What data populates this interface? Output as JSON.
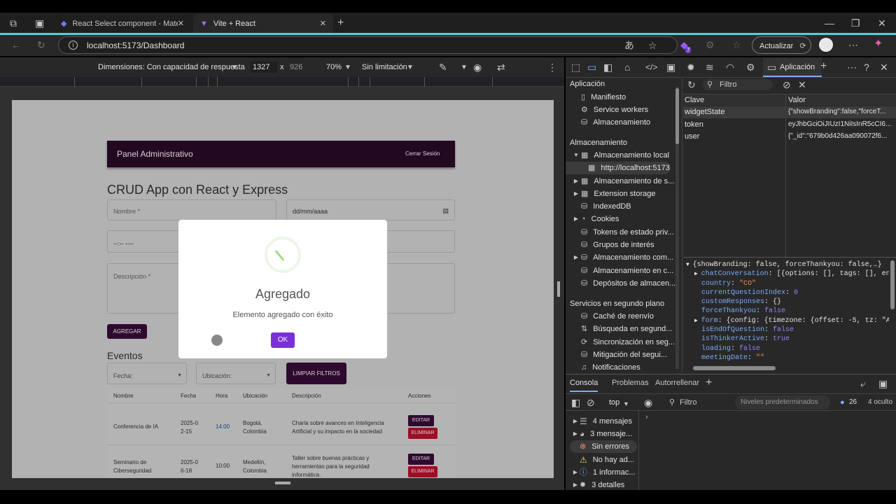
{
  "browser": {
    "tabs": [
      {
        "label": "React Select component - Materi"
      },
      {
        "label": "Vite + React"
      }
    ],
    "url": "localhost:5173/Dashboard",
    "update_label": "Actualizar",
    "ext_badge": "7"
  },
  "device_toolbar": {
    "dimensions_label": "Dimensiones: Con capacidad de respuesta",
    "width": "1327",
    "height": "926",
    "times": "x",
    "zoom": "70%",
    "throttle": "Sin limitación"
  },
  "app": {
    "header_title": "Panel Administrativo",
    "logout": "Cerrar Sesión",
    "page_title": "CRUD App con React y Express",
    "form": {
      "name_label": "Nombre *",
      "date_placeholder": "dd/mm/aaaa",
      "time_placeholder": "--:-- ----",
      "description_label": "Descripción *",
      "add_button": "AGREGAR"
    },
    "events_title": "Eventos",
    "filters": {
      "date": "Fecha:",
      "location": "Ubicación:",
      "clear": "LIMPIAR FILTROS"
    },
    "table": {
      "headers": [
        "Nombre",
        "Fecha",
        "Hora",
        "Ubicación",
        "Descripción",
        "Acciones"
      ],
      "rows": [
        {
          "name": "Conferencia de IA",
          "date": "2025-02-15",
          "time": "14:00",
          "location": "Bogotá, Colombia",
          "description": "Charla sobre avances en Inteligencia Artificial y su impacto en la sociedad"
        },
        {
          "name": "Seminario de Ciberseguridad",
          "date": "2025-06-18",
          "time": "10:00",
          "location": "Medellín, Colombia",
          "description": "Taller sobre buenas prácticas y herramientas para la seguridad informática."
        }
      ],
      "edit_label": "EDITAR",
      "delete_label": "ELIMINAR"
    },
    "modal": {
      "title": "Agregado",
      "message": "Elemento agregado con éxito",
      "ok": "OK"
    }
  },
  "devtools": {
    "panel_tab": "Aplicación",
    "sidebar": {
      "app_section": "Aplicación",
      "app_items": [
        "Manifiesto",
        "Service workers",
        "Almacenamiento"
      ],
      "storage_section": "Almacenamiento",
      "storage_items": [
        "Almacenamiento local",
        "http://localhost:5173",
        "Almacenamiento de s...",
        "Extension storage",
        "IndexedDB",
        "Cookies",
        "Tokens de estado priv...",
        "Grupos de interés",
        "Almacenamiento com...",
        "Almacenamiento en c...",
        "Depósitos de almacen..."
      ],
      "bg_section": "Servicios en segundo plano",
      "bg_items": [
        "Caché de reenvío",
        "Búsqueda en segund...",
        "Sincronización en seg...",
        "Mitigación del segui...",
        "Notificaciones"
      ]
    },
    "filter_placeholder": "Filtro",
    "table": {
      "key_header": "Clave",
      "value_header": "Valor",
      "rows": [
        {
          "key": "widgetState",
          "value": "{\"showBranding\":false,\"forceT..."
        },
        {
          "key": "token",
          "value": "eyJhbGciOiJIUzI1NiIsInR5cCI6..."
        },
        {
          "key": "user",
          "value": "{\"_id\":\"679b0d426aa090072f6..."
        }
      ]
    },
    "preview": {
      "root": "{showBranding: false, forceThankyou: false,…}",
      "lines": [
        {
          "k": "chatConversation",
          "v": "[{options: [], tags: [], enabl"
        },
        {
          "k": "country",
          "v": "\"CO\""
        },
        {
          "k": "currentQuestionIndex",
          "v": "0"
        },
        {
          "k": "customResponses",
          "v": "{}"
        },
        {
          "k": "forceThankyou",
          "v": "false"
        },
        {
          "k": "form",
          "v": "{config: {timezone: {offset: -5, tz: \"Amer"
        },
        {
          "k": "isEndOfQuestion",
          "v": "false"
        },
        {
          "k": "isThinkerActive",
          "v": "true"
        },
        {
          "k": "loading",
          "v": "false"
        },
        {
          "k": "meetingDate",
          "v": "\"\""
        }
      ]
    },
    "drawer": {
      "tabs": [
        "Consola",
        "Problemas",
        "Autorrellenar"
      ],
      "context": "top",
      "filter": "Filtro",
      "levels": "Niveles predeterminados",
      "issues_count": "26",
      "hidden": "4 oculto",
      "messages": [
        "4 mensajes",
        "3 mensaje...",
        "Sin errores",
        "No hay ad...",
        "1 informac...",
        "3 detalles"
      ]
    }
  },
  "colors": {
    "accent": "#4fd1d9",
    "app_header": "#2b0a2a",
    "primary": "#3a0d3a",
    "danger": "#c0122c",
    "ok": "#7b2fd6"
  }
}
